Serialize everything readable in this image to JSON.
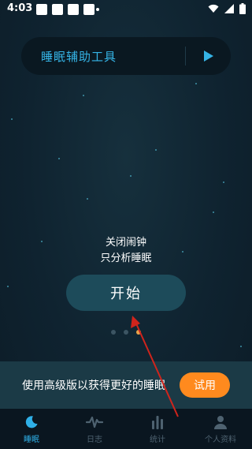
{
  "status_bar": {
    "time": "4:03"
  },
  "tool_banner": {
    "title": "睡眠辅助工具"
  },
  "main": {
    "mode_line1": "关闭闹钟",
    "mode_line2": "只分析睡眠",
    "start_label": "开始"
  },
  "promo": {
    "text": "使用高级版以获得更好的睡眠",
    "try_label": "试用"
  },
  "nav": {
    "items": [
      {
        "label": "睡眠",
        "icon": "moon-icon",
        "active": true
      },
      {
        "label": "日志",
        "icon": "waveform-icon",
        "active": false
      },
      {
        "label": "统计",
        "icon": "bar-chart-icon",
        "active": false
      },
      {
        "label": "个人资料",
        "icon": "person-icon",
        "active": false
      }
    ]
  },
  "colors": {
    "accent": "#35b4e6",
    "start_button": "#1d4b5a",
    "try_button": "#ff8a1e",
    "promo_bg": "#1b3a46",
    "annotation_arrow": "#d0241c"
  }
}
